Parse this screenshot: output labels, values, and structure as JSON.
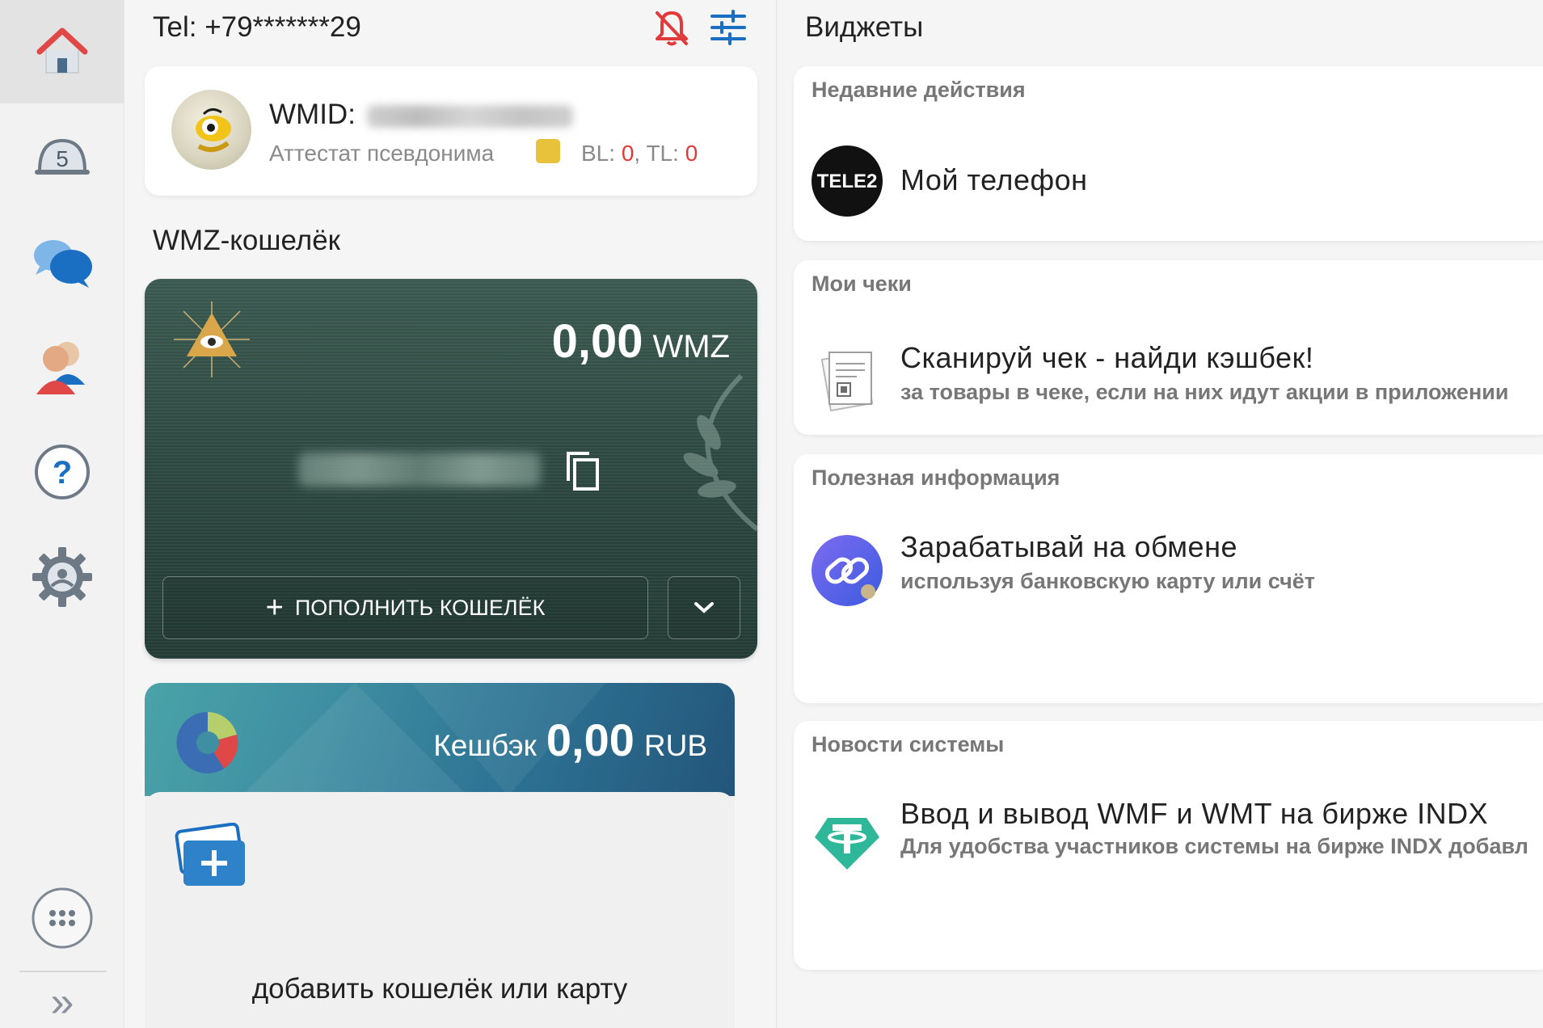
{
  "sidebar": {
    "items": [
      {
        "name": "home",
        "icon": "home-icon"
      },
      {
        "name": "notifications",
        "icon": "bell-count-icon",
        "badge": "5"
      },
      {
        "name": "messages",
        "icon": "chat-bubbles-icon"
      },
      {
        "name": "contacts",
        "icon": "contacts-icon"
      },
      {
        "name": "help",
        "icon": "help-icon",
        "glyph": "?"
      },
      {
        "name": "settings",
        "icon": "gear-icon"
      },
      {
        "name": "apps",
        "icon": "apps-grid-icon"
      },
      {
        "name": "expand",
        "icon": "double-chevron-icon",
        "glyph": "»"
      }
    ]
  },
  "header": {
    "tel": "Tel: +79*******29",
    "bell_icon": "bell-off-icon",
    "filter_icon": "sliders-icon"
  },
  "profile": {
    "wmid_label": "WMID:",
    "attestat": "Аттестат псевдонима",
    "bl_label": "BL:",
    "bl_value": "0",
    "tl_label": "TL:",
    "tl_value": "0"
  },
  "wallet": {
    "section_title": "WMZ-кошелёк",
    "amount": "0,00",
    "currency": "WMZ",
    "topup_label": "ПОПОЛНИТЬ КОШЕЛЁК"
  },
  "cashback": {
    "label": "Кешбэк",
    "amount": "0,00",
    "currency": "RUB",
    "add_label": "добавить кошелёк или карту"
  },
  "widgets": {
    "title": "Виджеты",
    "recent": {
      "label": "Недавние действия",
      "item_title": "Мой телефон",
      "logo_text": "TELE2"
    },
    "receipts": {
      "label": "Мои чеки",
      "item_title": "Сканируй чек - найди кэшбек!",
      "item_sub": "за товары в чеке, если на них идут акции в приложении"
    },
    "useful": {
      "label": "Полезная информация",
      "item_title": "Зарабатывай на обмене",
      "item_sub": "используя банковскую карту или счёт"
    },
    "news": {
      "label": "Новости системы",
      "item_title": "Ввод и вывод WMF и WMT на бирже INDX",
      "item_sub": "Для удобства участников системы на бирже INDX добавл"
    }
  },
  "colors": {
    "accent_red": "#e23a3a",
    "accent_blue": "#1a6fc2",
    "wallet_green": "#2f4b43",
    "cashback_teal": "#3f8fa2"
  }
}
